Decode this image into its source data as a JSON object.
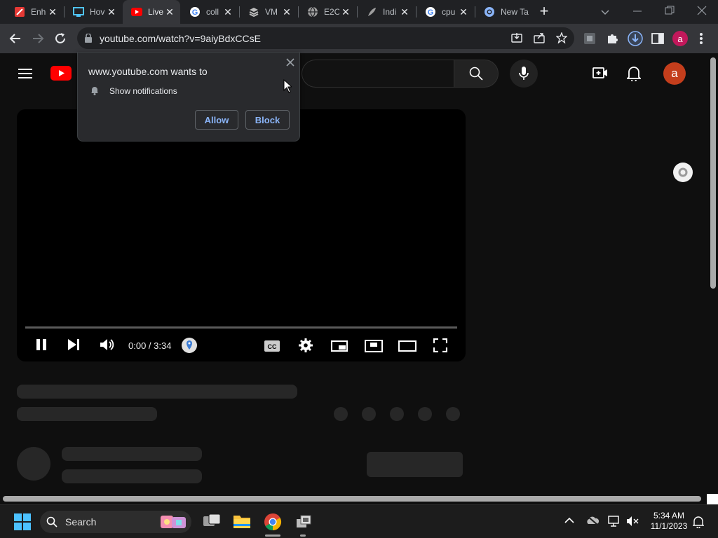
{
  "browser": {
    "tabs": [
      {
        "title": "Enh",
        "icon": "pdf-icon"
      },
      {
        "title": "Hov",
        "icon": "monitor-icon"
      },
      {
        "title": "Live",
        "icon": "youtube-icon"
      },
      {
        "title": "coll",
        "icon": "google-icon"
      },
      {
        "title": "VM",
        "icon": "vm-icon"
      },
      {
        "title": "E2C",
        "icon": "globe-icon"
      },
      {
        "title": "Indi",
        "icon": "feather-icon"
      },
      {
        "title": "cpu",
        "icon": "google-icon"
      },
      {
        "title": "New Tab",
        "icon": "chrome-icon"
      }
    ],
    "new_tab_glyph": "+",
    "url": "youtube.com/watch?v=9aiyBdxCCsE",
    "profile_initial": "a"
  },
  "popup": {
    "title": "www.youtube.com wants to",
    "permission": "Show notifications",
    "allow": "Allow",
    "block": "Block"
  },
  "youtube": {
    "avatar_initial": "a",
    "player": {
      "time": "0:00 / 3:34"
    }
  },
  "taskbar": {
    "search_label": "Search",
    "time": "5:34 AM",
    "date": "11/1/2023"
  },
  "colors": {
    "youtube_red": "#ff0000",
    "avatar_orange": "#c43e1c",
    "profile_pink": "#c2185b",
    "link_blue": "#8ab4f8"
  }
}
